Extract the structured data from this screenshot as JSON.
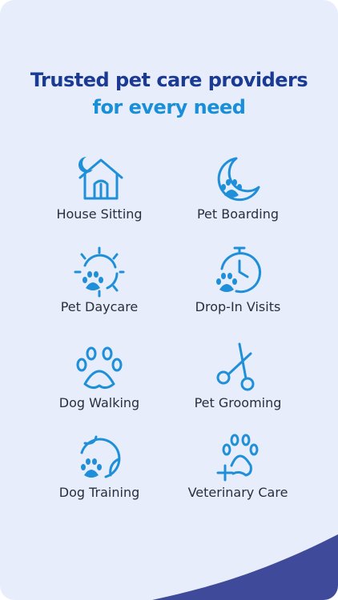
{
  "header": {
    "line1": "Trusted pet care providers",
    "line2": "for every need"
  },
  "services": [
    {
      "label": "House Sitting",
      "icon": "house-moon-icon"
    },
    {
      "label": "Pet Boarding",
      "icon": "moon-paw-icon"
    },
    {
      "label": "Pet Daycare",
      "icon": "sun-paw-icon"
    },
    {
      "label": "Drop-In Visits",
      "icon": "clock-paw-icon"
    },
    {
      "label": "Dog Walking",
      "icon": "paw-icon"
    },
    {
      "label": "Pet Grooming",
      "icon": "scissors-icon"
    },
    {
      "label": "Dog Training",
      "icon": "ball-paw-icon"
    },
    {
      "label": "Veterinary Care",
      "icon": "paw-medical-cross-icon"
    }
  ],
  "colors": {
    "background": "#e7edfa",
    "headline": "#1a3a94",
    "subheadline": "#1a8fd9",
    "icon": "#1e8fd8",
    "corner": "#3f4a9a"
  }
}
